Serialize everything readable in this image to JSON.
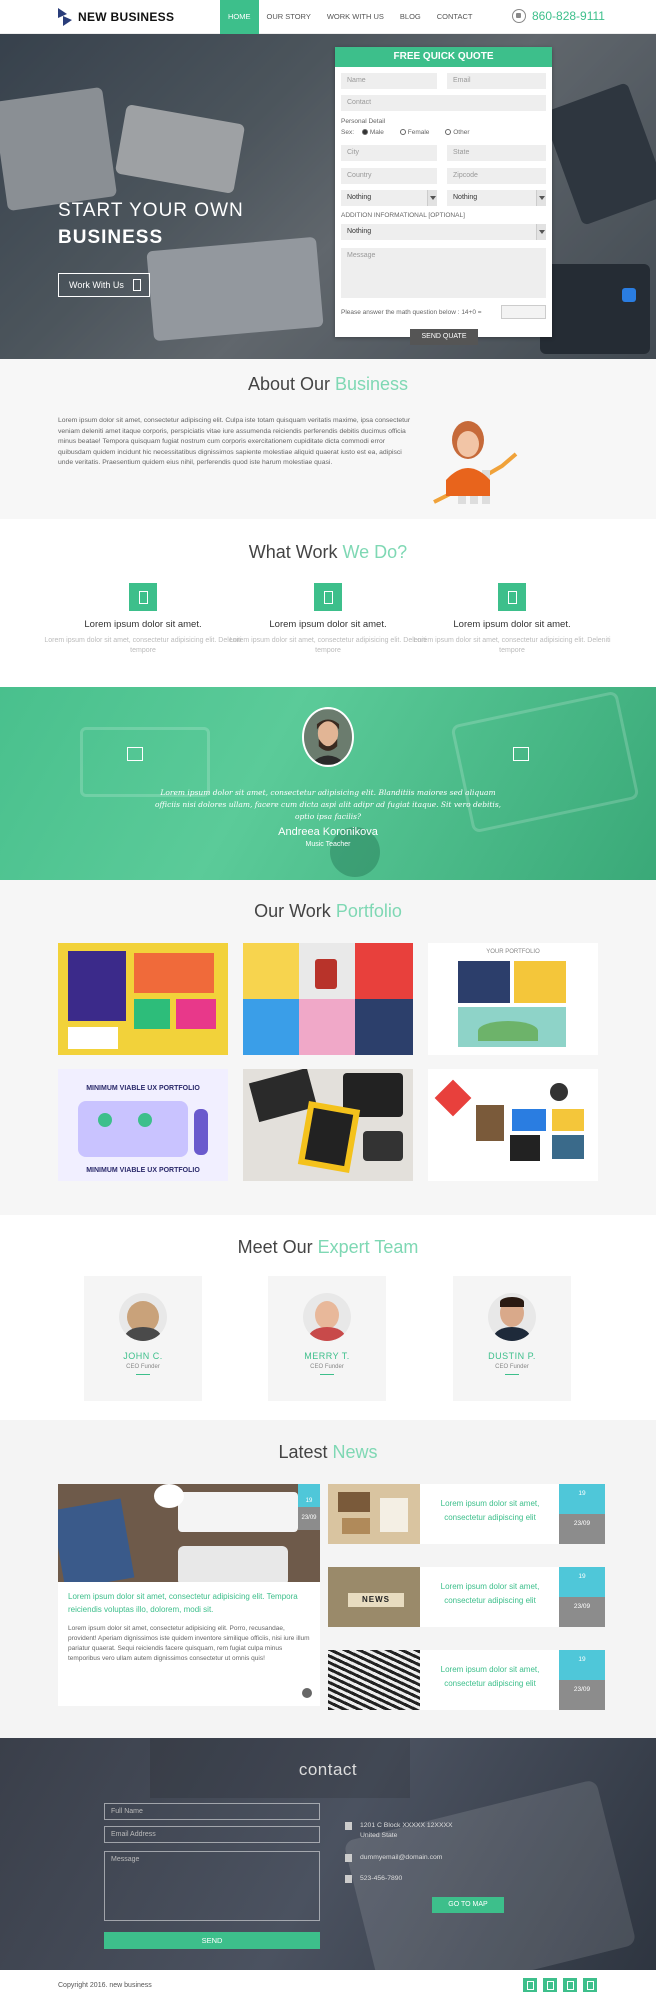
{
  "header": {
    "brand": "NEW BUSINESS",
    "nav": [
      "HOME",
      "OUR STORY",
      "WORK WITH US",
      "BLOG",
      "CONTACT"
    ],
    "active_nav": "HOME",
    "phone": "860-828-9111"
  },
  "hero": {
    "title_line1": "START YOUR OWN",
    "title_line2": "BUSINESS",
    "button": "Work With Us"
  },
  "quote_form": {
    "heading": "FREE QUICK QUOTE",
    "name_placeholder": "Name",
    "email_placeholder": "Email",
    "contact_placeholder": "Contact",
    "personal_detail_label": "Personal Detail",
    "sex_label": "Sex:",
    "sex_options": [
      "Male",
      "Female",
      "Other"
    ],
    "city_placeholder": "City",
    "state_placeholder": "State",
    "country_placeholder": "Country",
    "zip_placeholder": "Zipcode",
    "select1_value": "Nothing",
    "select2_value": "Nothing",
    "addition_label": "ADDITION INFORMATIONAL [OPTIONAL]",
    "select3_value": "Nothing",
    "message_placeholder": "Message",
    "math_label": "Please answer the math question below : 14+0 =",
    "send": "SEND QUATE"
  },
  "about": {
    "title_a": "About Our",
    "title_b": "Business",
    "text": "Lorem ipsum dolor sit amet, consectetur adipiscing elit. Culpa iste totam quisquam veritatis maxime, ipsa consectetur veniam deleniti amet itaque corporis, perspiciatis vitae iure assumenda reiciendis perferendis debitis ducimus officia minus beatae! Tempora quisquam fugiat nostrum cum corporis exercitationem cupiditate dicta commodi error quibusdam quidem incidunt hic necessitatibus dignissimos sapiente molestiae aliquid quaerat iusto est ea, adipisci unde veritatis. Praesentium quidem eius nihil, perferendis quod iste harum molestiae quasi."
  },
  "work": {
    "title_a": "What Work",
    "title_b": "We Do?",
    "cards": [
      {
        "title": "Lorem ipsum dolor sit amet.",
        "desc": "Lorem ipsum dolor sit amet, consectetur adipisicing elit. Deleniti tempore"
      },
      {
        "title": "Lorem ipsum dolor sit amet.",
        "desc": "Lorem ipsum dolor sit amet, consectetur adipisicing elit. Deleniti tempore"
      },
      {
        "title": "Lorem ipsum dolor sit amet.",
        "desc": "Lorem ipsum dolor sit amet, consectetur adipisicing elit. Deleniti tempore"
      }
    ]
  },
  "testimonial": {
    "quote": "Lorem ipsum dolor sit amet, consectetur adipisicing elit. Blanditiis maiores sed aliquam officiis nisi dolores ullam, facere cum dicta aspi alit adipr ad fugiat itaque. Sit vero debitis, optio ipsa facilis?",
    "name": "Andreea Koronikova",
    "role": "Music Teacher"
  },
  "portfolio": {
    "title_a": "Our Work",
    "title_b": "Portfolio",
    "tile3_caption": "YOUR PORTFOLIO",
    "tile4_caption_top": "MINIMUM VIABLE UX PORTFOLIO",
    "tile4_caption_bottom": "MINIMUM VIABLE UX PORTFOLIO"
  },
  "team": {
    "title_a": "Meet Our",
    "title_b": "Expert Team",
    "members": [
      {
        "name": "JOHN C.",
        "role": "CEO Funder"
      },
      {
        "name": "MERRY T.",
        "role": "CEO Funder"
      },
      {
        "name": "DUSTIN P.",
        "role": "CEO Funder"
      }
    ]
  },
  "news": {
    "title_a": "Latest",
    "title_b": "News",
    "featured": {
      "headline": "Lorem ipsum dolor sit amet, consectetur adipisicing elit. Tempora reiciendis voluptas illo, dolorem, modi sit.",
      "body": "Lorem ipsum dolor sit amet, consectetur adipisicing elit. Porro, recusandae, provident! Aperiam dignissimos iste quidem inventore similique officiis, nisi iure illum pariatur quaerat. Sequi reiciendis facere quisquam, rem fugiat culpa minus temporibus vero ullam autem dignissimos consectetur ut omnis quis!",
      "day": "19",
      "date": "23/09"
    },
    "items": [
      {
        "text": "Lorem ipsum dolor sit amet, consectetur adipiscing elit",
        "day": "19",
        "date": "23/09"
      },
      {
        "text": "Lorem ipsum dolor sit amet, consectetur adipiscing elit",
        "day": "19",
        "date": "23/09"
      },
      {
        "text": "Lorem ipsum dolor sit amet, consectetur adipiscing elit",
        "day": "19",
        "date": "23/09"
      }
    ],
    "news_img_text": "NEWS"
  },
  "contact": {
    "title": "contact",
    "name_placeholder": "Full Name",
    "email_placeholder": "Email Address",
    "message_placeholder": "Message",
    "send": "SEND",
    "address_line1": "1201 C Block XXXXX 12XXXX",
    "address_line2": "United State",
    "email": "dummyemail@domain.com",
    "phone": "523-456-7890",
    "map_button": "GO TO MAP"
  },
  "footer": {
    "copyright": "Copyright 2016. new business"
  },
  "colors": {
    "accent": "#3dbf8b",
    "accent_light": "#7fd8b4",
    "date_blue": "#4fc7d9"
  }
}
